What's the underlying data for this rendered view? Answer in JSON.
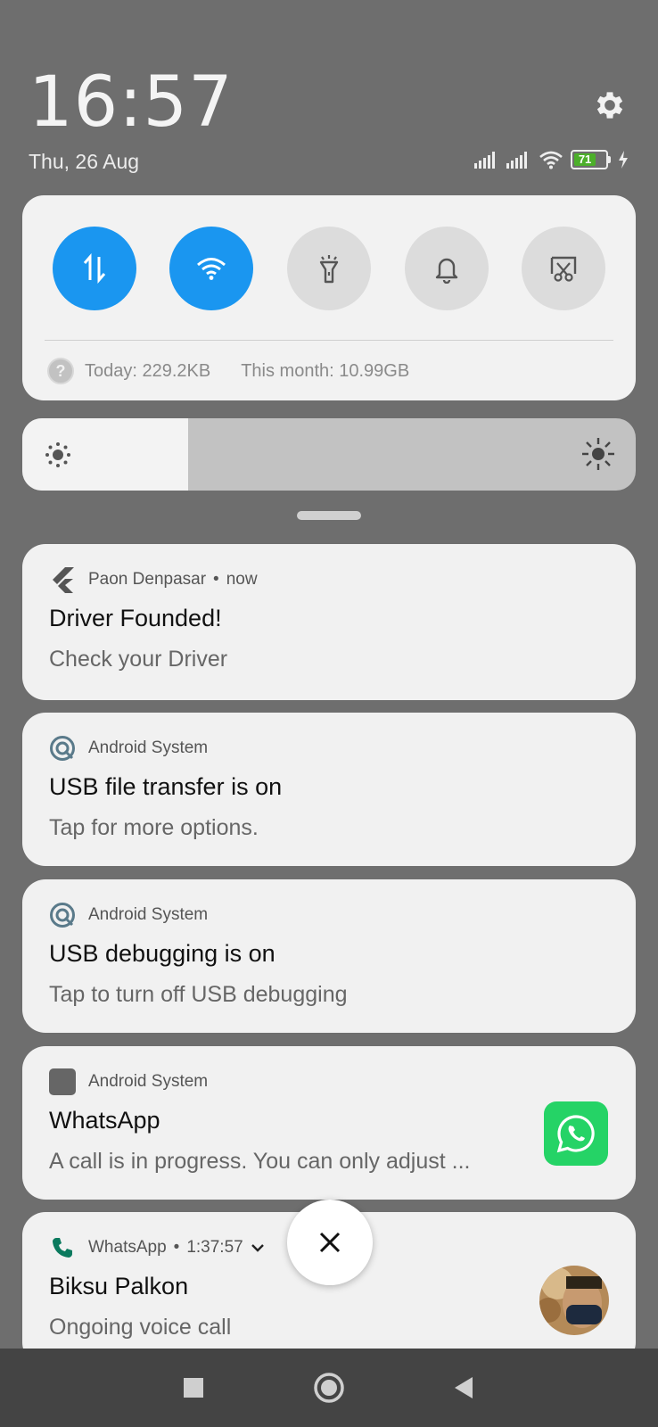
{
  "status_bar": {
    "time": "16:57",
    "date": "Thu, 26 Aug",
    "battery_level": "71",
    "battery_color": "#4caf2a",
    "icons": [
      "signal-icon",
      "signal-icon",
      "wifi-icon",
      "battery-icon",
      "charging-icon"
    ]
  },
  "quick_settings": {
    "tiles": [
      {
        "name": "mobile-data",
        "icon": "data-transfer-icon",
        "state": "on"
      },
      {
        "name": "wifi",
        "icon": "wifi-icon",
        "state": "on"
      },
      {
        "name": "flashlight",
        "icon": "flashlight-icon",
        "state": "off"
      },
      {
        "name": "sound",
        "icon": "bell-icon",
        "state": "off"
      },
      {
        "name": "screenshot",
        "icon": "screenshot-icon",
        "state": "off"
      }
    ],
    "accent_color": "#1a96f0",
    "usage_today": "Today: 229.2KB",
    "usage_month": "This month: 10.99GB"
  },
  "brightness": {
    "level": 0.27
  },
  "notifications": [
    {
      "app": "Paon Denpasar",
      "time": "now",
      "icon": "flutter-icon",
      "title": "Driver Founded!",
      "body": "Check your Driver"
    },
    {
      "app": "Android System",
      "icon": "android-system-icon",
      "title": "USB file transfer is on",
      "body": "Tap for more options."
    },
    {
      "app": "Android System",
      "icon": "android-system-icon",
      "title": "USB debugging is on",
      "body": "Tap to turn off USB debugging"
    },
    {
      "app": "Android System",
      "icon": "square-icon",
      "title": "WhatsApp",
      "body": "A call is in progress. You can only adjust ..."
    },
    {
      "app": "WhatsApp",
      "time": "1:37:57",
      "icon": "phone-icon",
      "title": "Biksu Palkon",
      "body": "Ongoing voice call"
    }
  ],
  "nav": [
    "recents-button",
    "home-button",
    "back-button"
  ]
}
